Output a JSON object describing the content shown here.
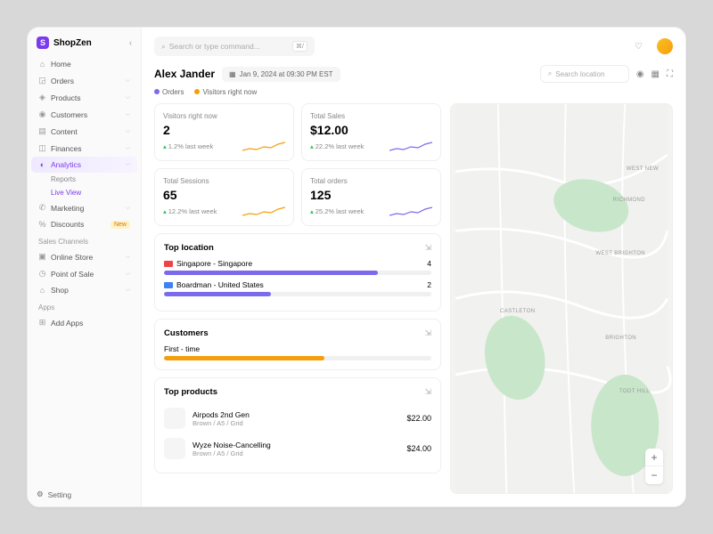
{
  "brand": "ShopZen",
  "sidebar": {
    "items": [
      {
        "icon": "⌂",
        "label": "Home"
      },
      {
        "icon": "◲",
        "label": "Orders",
        "chev": true
      },
      {
        "icon": "◈",
        "label": "Products",
        "chev": true
      },
      {
        "icon": "◉",
        "label": "Customers",
        "chev": true
      },
      {
        "icon": "▤",
        "label": "Content",
        "chev": true
      },
      {
        "icon": "◫",
        "label": "Finances",
        "chev": true
      },
      {
        "icon": "◐",
        "label": "Analytics",
        "chev": true,
        "active": true
      },
      {
        "icon": "✆",
        "label": "Marketing",
        "chev": true
      },
      {
        "icon": "%",
        "label": "Discounts",
        "badge": "New"
      }
    ],
    "subs": [
      {
        "label": "Reports"
      },
      {
        "label": "Live View",
        "active": true
      }
    ],
    "channels_hdr": "Sales Channels",
    "channels": [
      {
        "icon": "▣",
        "label": "Online Store",
        "chev": true
      },
      {
        "icon": "◷",
        "label": "Point of Sale",
        "chev": true
      },
      {
        "icon": "⌂",
        "label": "Shop",
        "chev": true
      }
    ],
    "apps_hdr": "Apps",
    "apps": [
      {
        "icon": "⊞",
        "label": "Add Apps"
      }
    ],
    "setting": {
      "icon": "⚙",
      "label": "Setting"
    }
  },
  "search": {
    "placeholder": "Search or type command...",
    "kbd": "⌘/"
  },
  "user": {
    "name": "Alex Jander"
  },
  "date": "Jan 9, 2024 at 09:30 PM EST",
  "loc_search": "Search location",
  "legend": {
    "orders": "Orders",
    "visitors": "Visitors right now"
  },
  "stats": [
    {
      "label": "Visitors right now",
      "value": "2",
      "trend": "1.2% last week",
      "color": "#f59e0b"
    },
    {
      "label": "Total Sales",
      "value": "$12.00",
      "trend": "22.2% last week",
      "color": "#7c6aed"
    },
    {
      "label": "Total Sessions",
      "value": "65",
      "trend": "12.2% last week",
      "color": "#f59e0b"
    },
    {
      "label": "Total orders",
      "value": "125",
      "trend": "25.2% last week",
      "color": "#7c6aed"
    }
  ],
  "top_location": {
    "title": "Top location",
    "rows": [
      {
        "flag": "#ef4444",
        "name": "Singapore - Singapore",
        "count": "4",
        "pct": 80
      },
      {
        "flag": "#3b82f6",
        "name": "Boardman - United States",
        "count": "2",
        "pct": 40
      }
    ]
  },
  "customers": {
    "title": "Customers",
    "label": "First - time",
    "pct": 60
  },
  "top_products": {
    "title": "Top products",
    "rows": [
      {
        "name": "Airpods 2nd Gen",
        "meta": "Brown / A5 / Grid",
        "price": "$22.00"
      },
      {
        "name": "Wyze Noise-Cancelling",
        "meta": "Brown / A5 / Grid",
        "price": "$24.00"
      }
    ]
  },
  "map_labels": [
    "WEST NEW",
    "RICHMOND",
    "WEST BRIGHTON",
    "CASTLETON",
    "BRIGHTON",
    "TODT HILL"
  ]
}
